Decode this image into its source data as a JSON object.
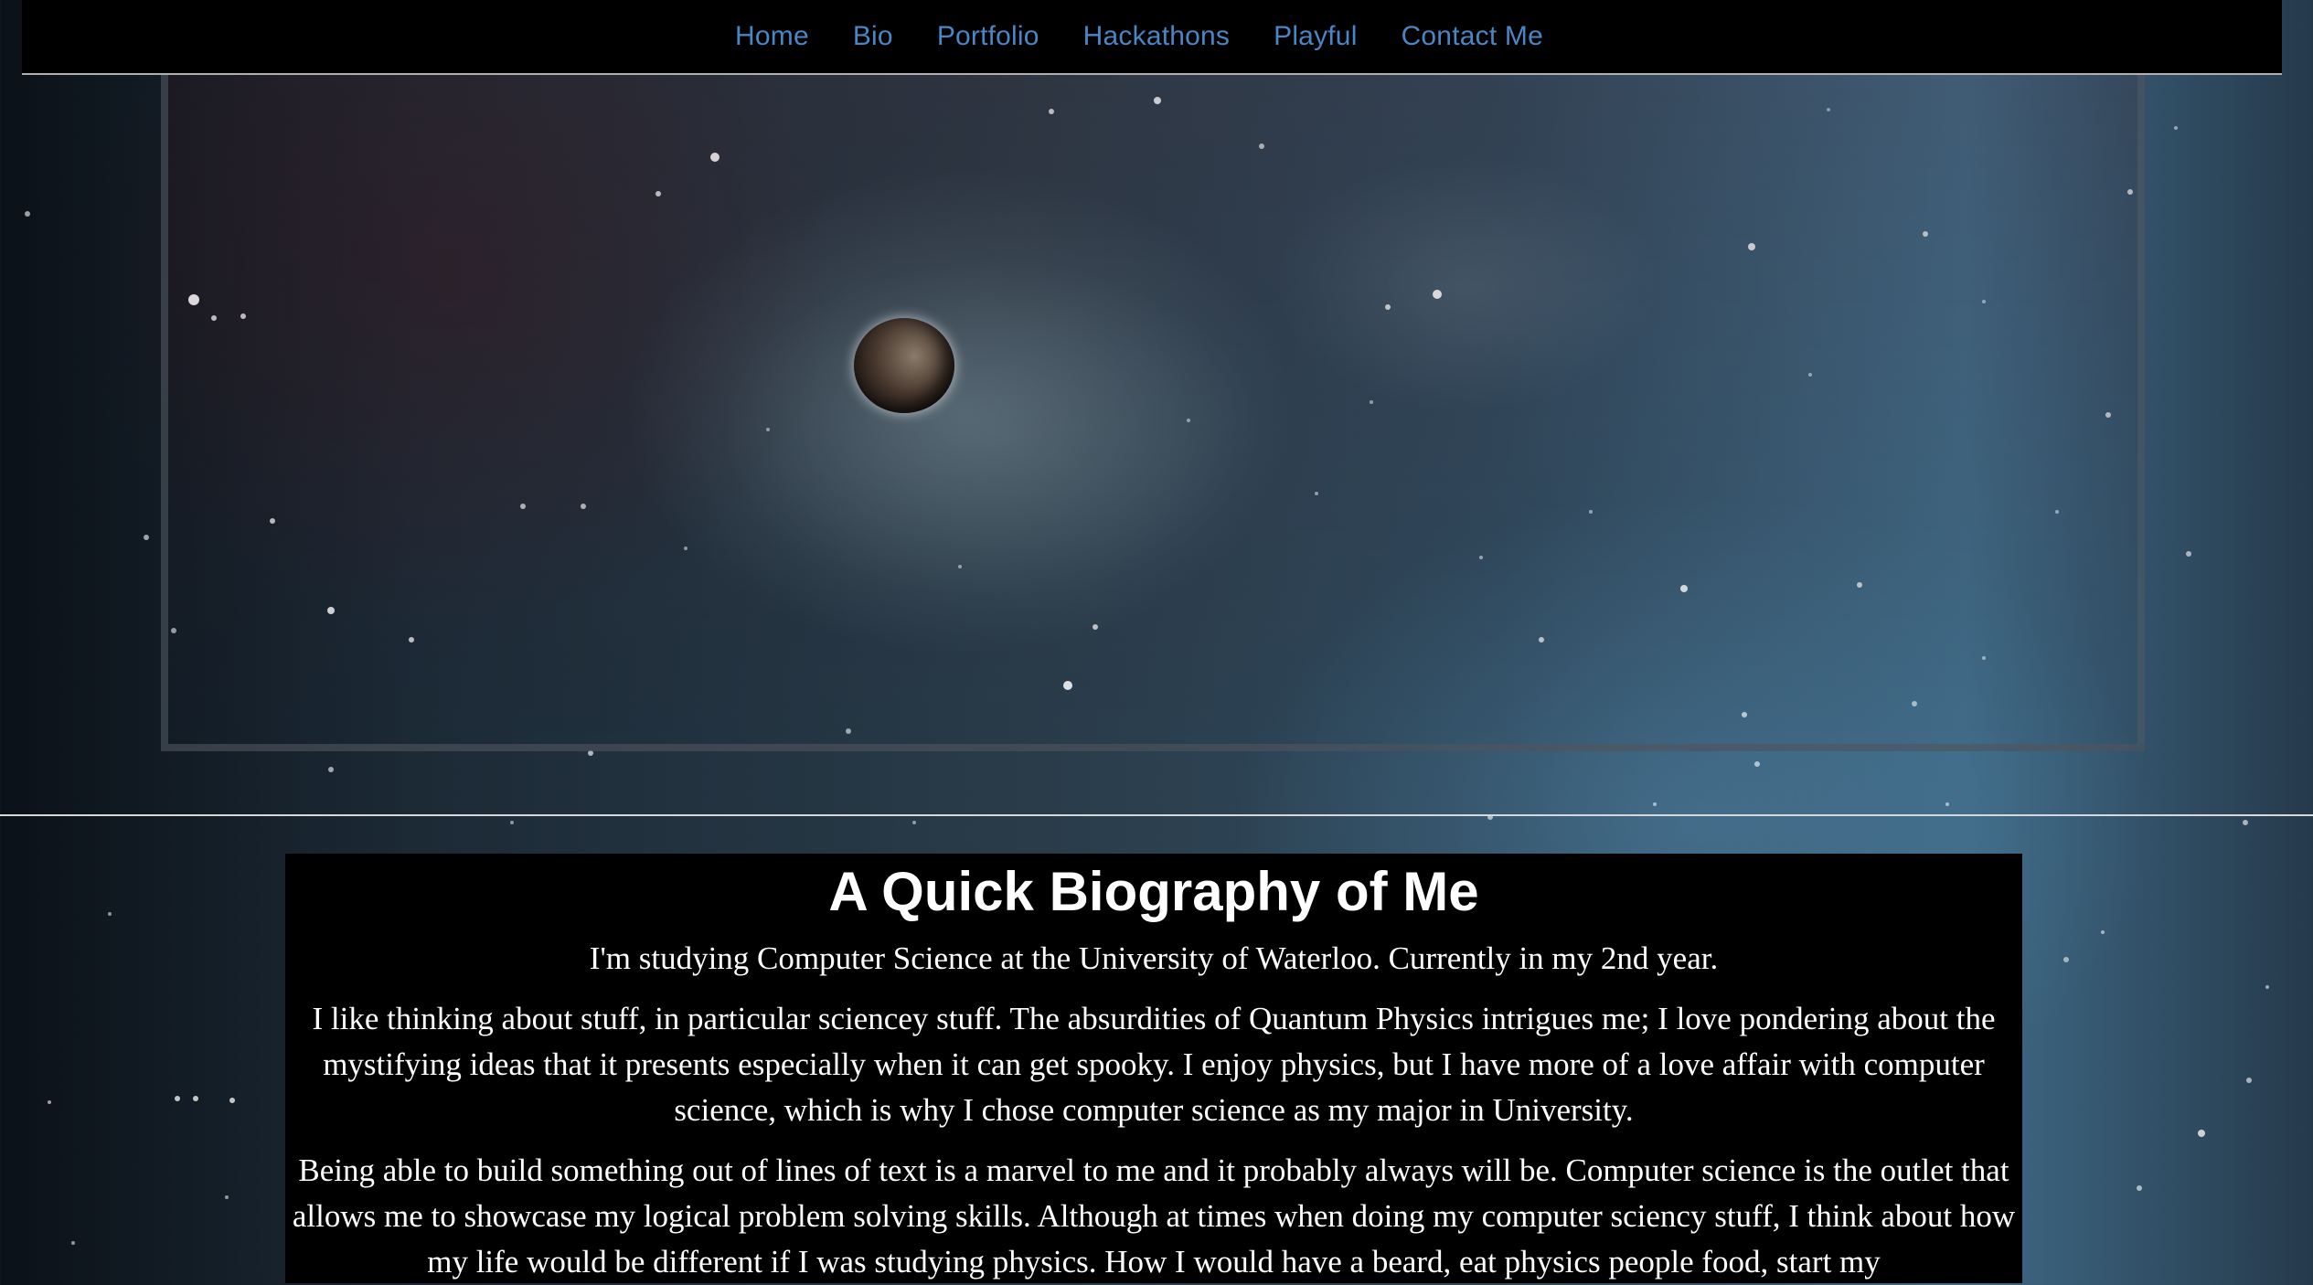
{
  "nav": {
    "items": [
      {
        "label": "Home"
      },
      {
        "label": "Bio"
      },
      {
        "label": "Portfolio"
      },
      {
        "label": "Hackathons"
      },
      {
        "label": "Playful"
      },
      {
        "label": "Contact Me"
      }
    ]
  },
  "bio": {
    "title": "A Quick Biography of Me",
    "paragraphs": [
      "I'm studying Computer Science at the University of Waterloo. Currently in my 2nd year.",
      "I like thinking about stuff, in particular sciencey stuff. The absurdities of Quantum Physics intrigues me; I love pondering about the mystifying ideas that it presents especially when it can get spooky. I enjoy physics, but I have more of a love affair with computer science, which is why I chose computer science as my major in University.",
      "Being able to build something out of lines of text is a marvel to me and it probably always will be. Computer science is the outlet that allows me to showcase my logical problem solving skills. Although at times when doing my computer sciency stuff, I think about how my life would be different if I was studying physics. How I would have a beard, eat physics people food, start my"
    ]
  },
  "colors": {
    "nav_link": "#4a86c5",
    "nav_bg": "#000000",
    "panel_bg": "#000000",
    "panel_text": "#ffffff"
  }
}
